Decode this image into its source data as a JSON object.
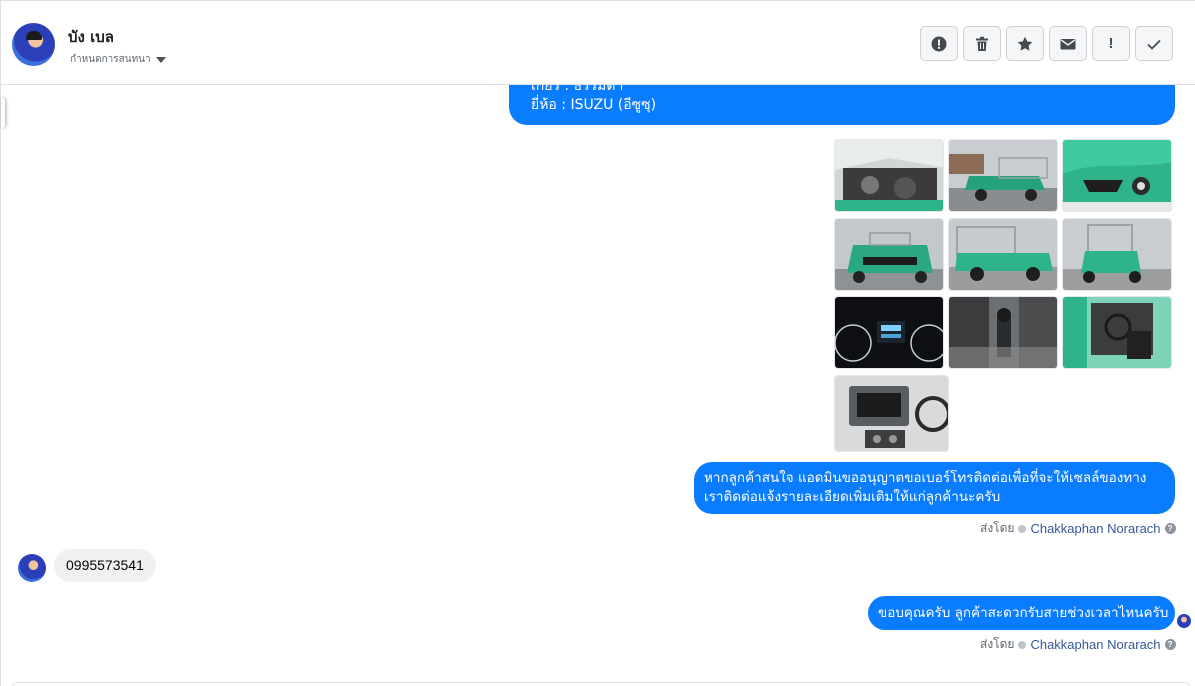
{
  "header": {
    "contact_name": "บัง เบล",
    "assign_label": "กำหนดการสนทนา",
    "toolbar": [
      "spam-report",
      "delete",
      "star",
      "mark-unread",
      "important",
      "done"
    ]
  },
  "messages": {
    "top_bubble_lines": [
      "เกียร์ : ธรรมดา",
      "ยี่ห้อ : ISUZU (อีซูซุ)"
    ],
    "photos": [
      "engine-bay",
      "pickup-front-quarter",
      "headlight-closeup",
      "pickup-front",
      "pickup-side",
      "pickup-rear",
      "gauge-cluster",
      "gear-shifter",
      "driver-cabin",
      "dashboard-console"
    ],
    "admin_message": "หากลูกค้าสนใจ แอดมินขออนุญาตขอเบอร์โทรติดต่อเพื่อที่จะให้เซลล์ของทางเราติดต่อแจ้งรายละเอียดเพิ่มเติมให้แก่ลูกค้านะครับ",
    "sent_by_label": "ส่งโดย",
    "sent_by_name": "Chakkaphan Norarach",
    "customer_reply": "0995573541",
    "last_message": "ขอบคุณครับ ลูกค้าสะดวกรับสายช่วงเวลาไหนครับ",
    "sent_by_label_2": "ส่งโดย",
    "sent_by_name_2": "Chakkaphan Norarach"
  },
  "colors": {
    "outgoing": "#0a7cff",
    "incoming": "#f1f0f0",
    "car_green": "#2fb38a"
  }
}
